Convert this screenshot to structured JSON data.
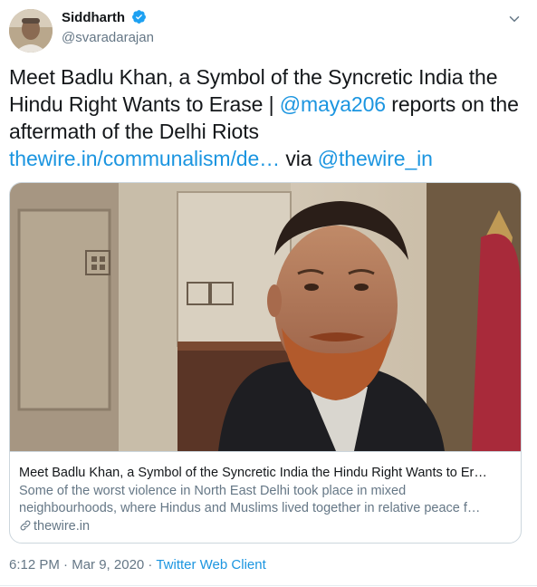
{
  "tweet": {
    "author": {
      "name": "Siddharth",
      "handle": "@svaradarajan",
      "verified": true
    },
    "text": {
      "part1": "Meet Badlu Khan, a Symbol of the Syncretic India the Hindu Right Wants to Erase | ",
      "mention1": "@maya206",
      "part2": " reports on the aftermath of the Delhi Riots ",
      "url": "thewire.in/communalism/de…",
      "part3": " via ",
      "mention2": "@thewire_in"
    },
    "card": {
      "title": "Meet Badlu Khan, a Symbol of the Syncretic India the Hindu Right Wants to Er…",
      "description_line1": "Some of the worst violence in North East Delhi took place in mixed",
      "description_line2": "neighbourhoods, where Hindus and Muslims lived together in relative peace f…",
      "domain": "thewire.in"
    },
    "meta": {
      "time": "6:12 PM",
      "separator1": " · ",
      "date": "Mar 9, 2020",
      "separator2": " · ",
      "source": "Twitter Web Client"
    }
  },
  "colors": {
    "link": "#1b95e0",
    "verified": "#1da1f2",
    "secondary_text": "#657786",
    "border": "#ccd6dd"
  },
  "icons": [
    "verified-badge-icon",
    "chevron-down-icon",
    "link-icon"
  ]
}
